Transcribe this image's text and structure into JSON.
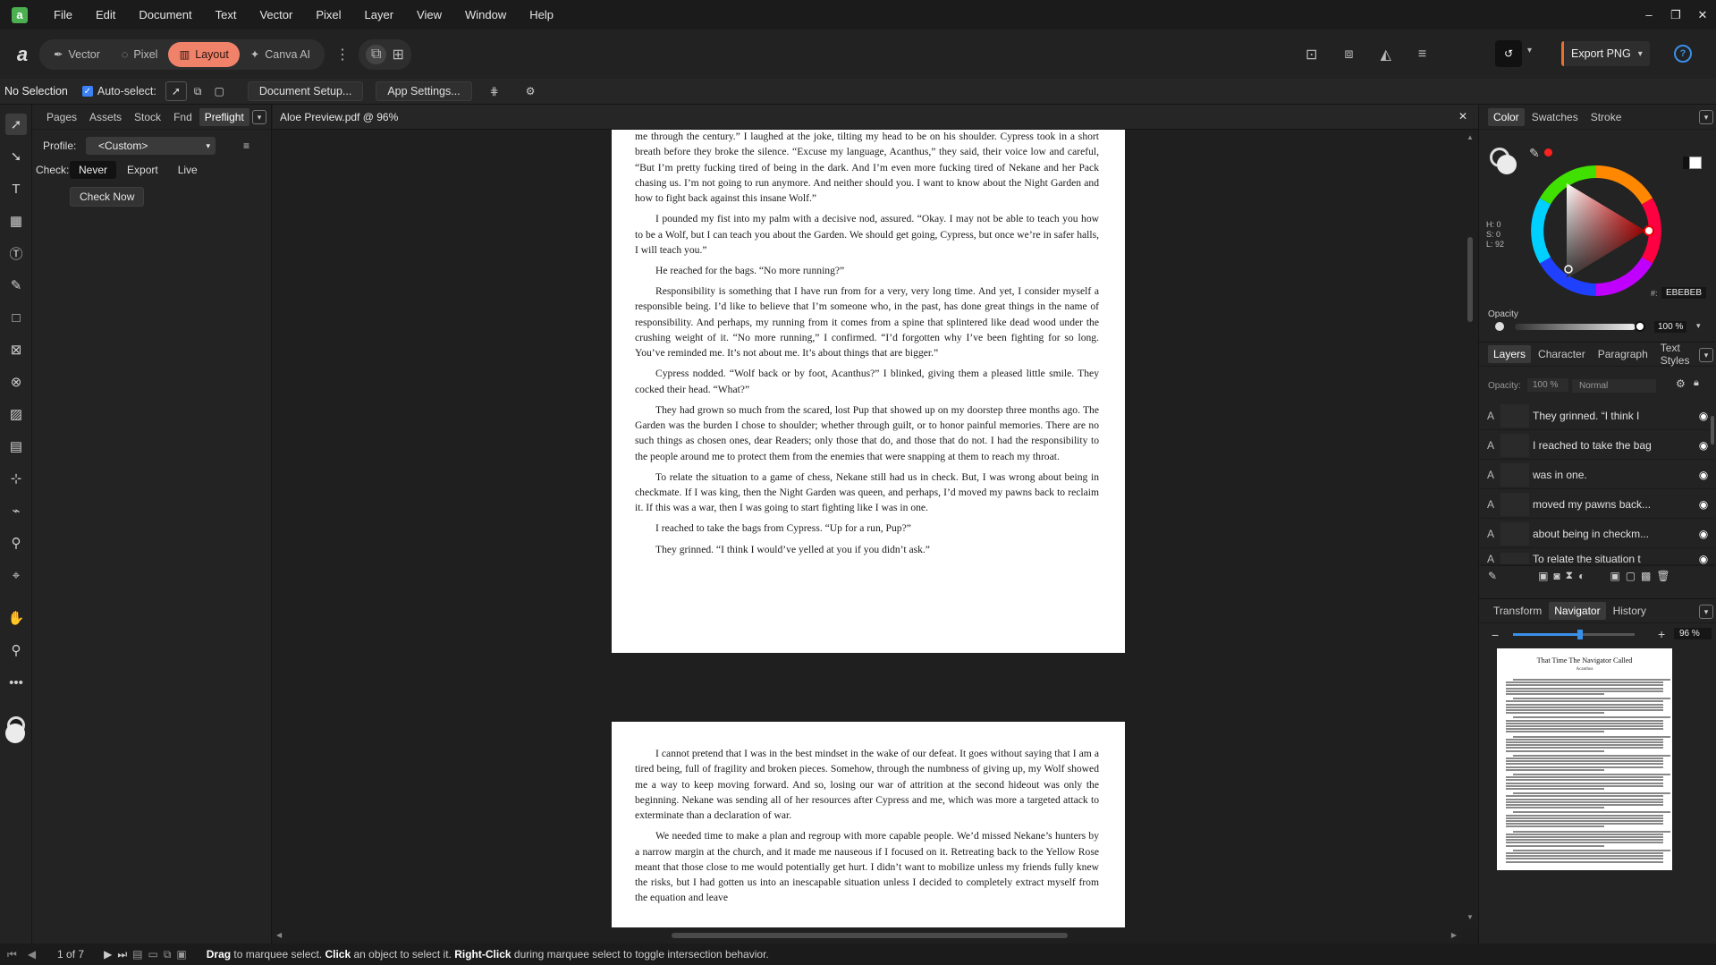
{
  "menubar": {
    "items": [
      "File",
      "Edit",
      "Document",
      "Text",
      "Vector",
      "Pixel",
      "Layer",
      "View",
      "Window",
      "Help"
    ]
  },
  "toolbar": {
    "personas": [
      "Vector",
      "Pixel",
      "Layout",
      "Canva AI"
    ],
    "active_persona": "Layout",
    "export_label": "Export PNG"
  },
  "context": {
    "selection": "No Selection",
    "autoselect_label": "Auto-select:",
    "document_setup": "Document Setup...",
    "app_settings": "App Settings..."
  },
  "left_panel": {
    "tabs": [
      "Pages",
      "Assets",
      "Stock",
      "Fnd",
      "Preflight"
    ],
    "active_tab": "Preflight",
    "profile_label": "Profile:",
    "profile_value": "<Custom>",
    "check_label": "Check:",
    "check_options": [
      "Never",
      "Export",
      "Live"
    ],
    "check_now": "Check Now"
  },
  "document": {
    "tab_title": "Aloe Preview.pdf @ 96%",
    "page1_paragraphs": [
      "me through the century.” I laughed at the joke, tilting my head to be on his shoulder. Cypress took in a short breath before they broke the silence. “Excuse my language, Acanthus,” they said, their voice low and careful, “But I’m pretty fucking tired of being in the dark. And I’m even more fucking tired of Nekane and her Pack chasing us. I’m not going to run anymore. And neither should you. I want to know about the Night Garden and how to fight back against this insane Wolf.”",
      "I pounded my fist into my palm with a decisive nod, assured. “Okay. I may not be able to teach you how to be a Wolf, but I can teach you about the Garden. We should get going, Cypress, but once we’re in safer halls, I will teach you.”",
      "He reached for the bags. “No more running?”",
      "Responsibility is something that I have run from for a very, very long time. And yet, I consider myself a responsible being. I’d like to believe that I’m someone who, in the past, has done great things in the name of responsibility. And perhaps, my running from it comes from a spine that splintered like dead wood under the crushing weight of it. “No more running,” I confirmed. “I’d forgotten why I’ve been fighting for so long. You’ve reminded me. It’s not about me. It’s about things that are bigger.”",
      "Cypress nodded. “Wolf back or by foot, Acanthus?” I blinked, giving them a pleased little smile. They cocked their head. “What?”",
      "They had grown so much from the scared, lost Pup that showed up on my doorstep three months ago. The Garden was the burden I chose to shoulder; whether through guilt, or to honor painful memories. There are no such things as chosen ones, dear Readers; only those that do, and those that do not. I had the responsibility to the people around me to protect them from the enemies that were snapping at them to reach my throat.",
      "To relate the situation to a game of chess, Nekane still had us in check. But, I was wrong about being in checkmate. If I was king, then the Night Garden was queen, and perhaps, I’d moved my pawns back to reclaim it. If this was a war, then I was going to start fighting like I was in one.",
      "I reached to take the bags from Cypress. “Up for a run, Pup?”",
      "They grinned. “I think I would’ve yelled at you if you didn’t ask.”"
    ],
    "page2_paragraphs": [
      "I cannot pretend that I was in the best mindset in the wake of our defeat. It goes without saying that I am a tired being, full of fragility and broken pieces. Somehow, through the numbness of giving up, my Wolf showed me a way to keep moving forward. And so, losing our war of attrition at the second hideout was only the beginning. Nekane was sending all of her resources after Cypress and me, which was more a targeted attack to exterminate than a declaration of war.",
      "We needed time to make a plan and regroup with more capable people. We’d missed Nekane’s hunters by a narrow margin at the church, and it made me nauseous if I focused on it. Retreating back to the Yellow Rose meant that those close to me would potentially get hurt. I didn’t want to mobilize unless my friends fully knew the risks, but I had gotten us into an inescapable situation unless I decided to completely extract myself from the equation and leave"
    ]
  },
  "color_panel": {
    "tabs": [
      "Color",
      "Swatches",
      "Stroke"
    ],
    "h": "H: 0",
    "s": "S: 0",
    "l": "L: 92",
    "hex": "EBEBEB",
    "opacity_label": "Opacity",
    "opacity_value": "100 %",
    "fill_color": "#ebebeb",
    "hue_marker_color": "#ff0000"
  },
  "layers_panel": {
    "tabs": [
      "Layers",
      "Character",
      "Paragraph",
      "Text Styles"
    ],
    "opacity_label": "Opacity:",
    "opacity_value": "100 %",
    "blend_mode": "Normal",
    "layers": [
      {
        "kind": "A",
        "name": "They grinned. “I think I"
      },
      {
        "kind": "A",
        "name": "I reached to take the bag"
      },
      {
        "kind": "A",
        "name": "was in one."
      },
      {
        "kind": "A",
        "name": "moved my pawns back..."
      },
      {
        "kind": "A",
        "name": "about being in checkm..."
      },
      {
        "kind": "A",
        "name": "To relate the situation t"
      }
    ]
  },
  "navigator_panel": {
    "tabs": [
      "Transform",
      "Navigator",
      "History"
    ],
    "active_tab": "Navigator",
    "zoom_value": "96 %",
    "zoom_fraction": 0.55,
    "thumb_title": "That Time The Navigator Called",
    "thumb_author": "Acanthus"
  },
  "statusbar": {
    "page_indicator": "1 of 7",
    "drag": "Drag",
    "text1": " to marquee select. ",
    "click": "Click",
    "text2": " an object to select it. ",
    "right_click": "Right-Click",
    "text3": " during marquee select to toggle intersection behavior."
  }
}
